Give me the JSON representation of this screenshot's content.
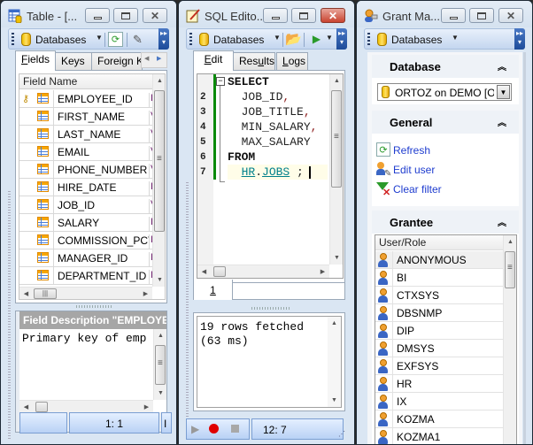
{
  "windows": {
    "table": {
      "title": "Table - [...",
      "toolbar": {
        "databases_label": "Databases"
      },
      "tabs": [
        {
          "label": "Fields",
          "accel": "F",
          "rest": "ields",
          "active": true
        },
        {
          "label": "Keys",
          "active": false
        },
        {
          "label": "Foreign Ke",
          "active": false
        }
      ],
      "grid": {
        "header": "Field Name",
        "rows": [
          {
            "name": "EMPLOYEE_ID",
            "pk": true,
            "type_glyph": "I"
          },
          {
            "name": "FIRST_NAME",
            "pk": false,
            "type_glyph": "V"
          },
          {
            "name": "LAST_NAME",
            "pk": false,
            "type_glyph": "V"
          },
          {
            "name": "EMAIL",
            "pk": false,
            "type_glyph": "V"
          },
          {
            "name": "PHONE_NUMBER",
            "pk": false,
            "type_glyph": "V"
          },
          {
            "name": "HIRE_DATE",
            "pk": false,
            "type_glyph": "I"
          },
          {
            "name": "JOB_ID",
            "pk": false,
            "type_glyph": "V"
          },
          {
            "name": "SALARY",
            "pk": false,
            "type_glyph": "I"
          },
          {
            "name": "COMMISSION_PCT",
            "pk": false,
            "type_glyph": "I"
          },
          {
            "name": "MANAGER_ID",
            "pk": false,
            "type_glyph": "I"
          },
          {
            "name": "DEPARTMENT_ID",
            "pk": false,
            "type_glyph": "I"
          }
        ]
      },
      "description_header": "Field Description \"EMPLOYEE_ID\"",
      "description_text": "Primary key of empl",
      "status": {
        "position": "1:   1",
        "mode": "I"
      }
    },
    "sql_editor": {
      "title": "SQL Edito...",
      "toolbar": {
        "databases_label": "Databases"
      },
      "tabs": [
        {
          "accel": "E",
          "rest": "dit",
          "active": true
        },
        {
          "pre": "Res",
          "accel": "u",
          "rest": "lts",
          "active": false
        },
        {
          "accel": "L",
          "rest": "ogs",
          "active": false
        }
      ],
      "code": [
        {
          "num": "",
          "tokens": [
            {
              "t": "kw",
              "v": "SELECT"
            }
          ]
        },
        {
          "num": "2",
          "tokens": [
            {
              "t": "id",
              "v": "  JOB_ID"
            },
            {
              "t": "punct",
              "v": ","
            }
          ]
        },
        {
          "num": "3",
          "tokens": [
            {
              "t": "id",
              "v": "  JOB_TITLE"
            },
            {
              "t": "punct",
              "v": ","
            }
          ]
        },
        {
          "num": "4",
          "tokens": [
            {
              "t": "id",
              "v": "  MIN_SALARY"
            },
            {
              "t": "punct",
              "v": ","
            }
          ]
        },
        {
          "num": "5",
          "tokens": [
            {
              "t": "id",
              "v": "  MAX_SALARY"
            }
          ]
        },
        {
          "num": "6",
          "tokens": [
            {
              "t": "kw",
              "v": "FROM"
            }
          ]
        },
        {
          "num": "7",
          "tokens": [
            {
              "t": "sp",
              "v": "  "
            },
            {
              "t": "obj",
              "v": "HR"
            },
            {
              "t": "id",
              "v": "."
            },
            {
              "t": "obj",
              "v": "JOBS"
            },
            {
              "t": "id",
              "v": " ;"
            }
          ]
        }
      ],
      "editor_page_tab": "1",
      "messages": [
        "19 rows fetched",
        "(63 ms)"
      ],
      "status": {
        "position": "12:   7"
      }
    },
    "grant_manager": {
      "title": "Grant Ma...",
      "toolbar": {
        "databases_label": "Databases"
      },
      "sections": {
        "database": {
          "title": "Database",
          "selected": "ORTOZ on DEMO [ORTOZ]",
          "selected_visible": "ORTOZ on DEMO [OI"
        },
        "general": {
          "title": "General",
          "links": [
            {
              "label": "Refresh",
              "icon": "refresh-icon"
            },
            {
              "label": "Edit user",
              "icon": "edit-user-icon"
            },
            {
              "label": "Clear filter",
              "icon": "clear-filter-icon"
            }
          ]
        },
        "grantee": {
          "title": "Grantee",
          "header": "User/Role",
          "users": [
            "ANONYMOUS",
            "BI",
            "CTXSYS",
            "DBSNMP",
            "DIP",
            "DMSYS",
            "EXFSYS",
            "HR",
            "IX",
            "KOZMA",
            "KOZMA1"
          ]
        }
      }
    }
  },
  "colors": {
    "link": "#1e3ccf",
    "gutter_bar": "#0a8a0a",
    "current_line": "#fffde8",
    "object_name": "#00808b"
  }
}
